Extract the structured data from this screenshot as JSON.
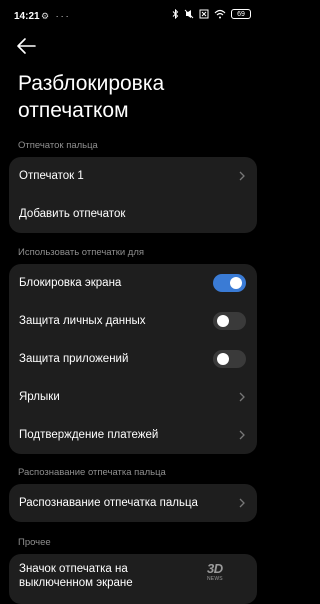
{
  "status_bar": {
    "time": "14:21",
    "left_icons": "⚙ ···",
    "battery": "69"
  },
  "page": {
    "title": "Разблокировка отпечатком"
  },
  "sections": {
    "fingerprint": {
      "label": "Отпечаток пальца",
      "items": [
        "Отпечаток 1",
        "Добавить отпечаток"
      ]
    },
    "use_for": {
      "label": "Использовать отпечатки для",
      "items": [
        {
          "label": "Блокировка экрана",
          "toggle": true
        },
        {
          "label": "Защита личных данных",
          "toggle": false
        },
        {
          "label": "Защита приложений",
          "toggle": false
        },
        {
          "label": "Ярлыки"
        },
        {
          "label": "Подтверждение платежей"
        }
      ]
    },
    "recognition": {
      "label": "Распознавание отпечатка пальца",
      "items": [
        "Распознавание отпечатка пальца"
      ]
    },
    "other": {
      "label": "Прочее",
      "items": [
        "Значок отпечатка на выключенном экране"
      ]
    }
  },
  "watermark": {
    "big": "3D",
    "small": "NEWS"
  },
  "colors": {
    "accent": "#3a7bd5",
    "card": "#1e1e1e",
    "section_label": "#8f8f8f",
    "background": "#000000"
  }
}
